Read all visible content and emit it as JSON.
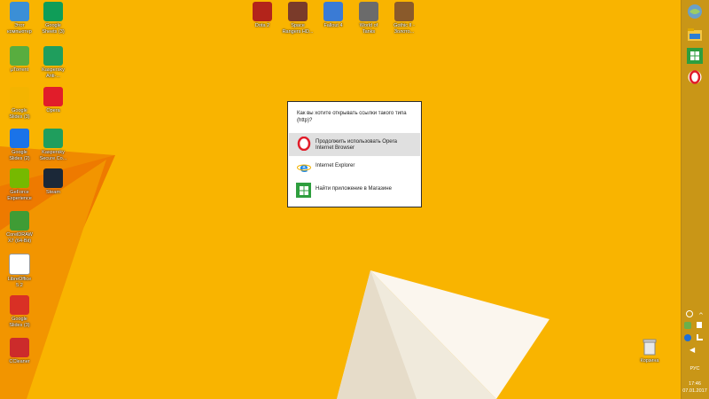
{
  "desktop_icons": [
    {
      "label": "Этот\nкомпьютер",
      "icon": "computer-icon",
      "color": "#3b8fd6"
    },
    {
      "label": "Google\nSheets (3)",
      "icon": "google-sheets-icon",
      "color": "#0f9d58"
    },
    {
      "label": "µTorrent",
      "icon": "utorrent-icon",
      "color": "#58ad3f"
    },
    {
      "label": "Kaspersky\nAnti-...",
      "icon": "kaspersky-icon",
      "color": "#1f9e5d"
    },
    {
      "label": "Google\nSlides (3)",
      "icon": "google-slides-icon",
      "color": "#f4b400"
    },
    {
      "label": "Opera",
      "icon": "opera-icon",
      "color": "#e11d2a"
    },
    {
      "label": "Google\nSlides (2)",
      "icon": "google-docs-icon",
      "color": "#1a73e8"
    },
    {
      "label": "Kaspersky\nSecure Co...",
      "icon": "kaspersky-secure-icon",
      "color": "#1f9e5d"
    },
    {
      "label": "GeForce\nExperience",
      "icon": "geforce-icon",
      "color": "#76b900"
    },
    {
      "label": "Steam",
      "icon": "steam-icon",
      "color": "#1b2838"
    },
    {
      "label": "CorelDRAW\nX7 (64-Bit)",
      "icon": "coreldraw-icon",
      "color": "#3f9c35"
    },
    {
      "label": "LibreOffice\n5.2",
      "icon": "libreoffice-icon",
      "color": "#ffffff"
    },
    {
      "label": "Google\nSlides (3)",
      "icon": "google-slides2-icon",
      "color": "#d93025"
    },
    {
      "label": "CCleaner",
      "icon": "ccleaner-icon",
      "color": "#cc2b2b"
    }
  ],
  "game_icons": [
    {
      "label": "Dota 2",
      "icon": "dota2-icon",
      "color": "#b3241b"
    },
    {
      "label": "Space\nRangers HD...",
      "icon": "space-rangers-icon",
      "color": "#7a3b2a"
    },
    {
      "label": "Fallout 4",
      "icon": "fallout4-icon",
      "color": "#3a7bd5"
    },
    {
      "label": "World of\nTanks",
      "icon": "wot-icon",
      "color": "#6b6b6b"
    },
    {
      "label": "Gothic II -\nЗолото...",
      "icon": "gothic-icon",
      "color": "#8a5a2b"
    }
  ],
  "recycle_bin": {
    "label": "Корзина",
    "icon": "recycle-bin-icon"
  },
  "dialog": {
    "prompt": "Как вы хотите открывать ссылки такого типа (http)?",
    "options": [
      {
        "label": "Продолжить использовать Opera Internet Browser",
        "icon": "opera-icon",
        "selected": true
      },
      {
        "label": "Internet Explorer",
        "icon": "internet-explorer-icon",
        "selected": false
      },
      {
        "label": "Найти приложение в Магазине",
        "icon": "store-icon",
        "selected": false
      }
    ]
  },
  "taskbar": {
    "pinned": [
      {
        "name": "ie-globe-icon"
      },
      {
        "name": "file-explorer-icon"
      },
      {
        "name": "store-icon"
      },
      {
        "name": "opera-icon"
      }
    ],
    "tray": [
      "opera-tray-icon",
      "show-hidden-icons",
      "shield-icon",
      "flag-icon",
      "bluetooth-icon",
      "network-icon",
      "volume-icon"
    ],
    "language": "РУС",
    "time": "17:46",
    "date": "07.01.2017"
  },
  "colors": {
    "desktop_bg": "#f9b400",
    "taskbar_bg": "#c99617",
    "opera_red": "#e11d2a",
    "ie_blue": "#1e88e5",
    "store_green": "#2e9e3e"
  }
}
